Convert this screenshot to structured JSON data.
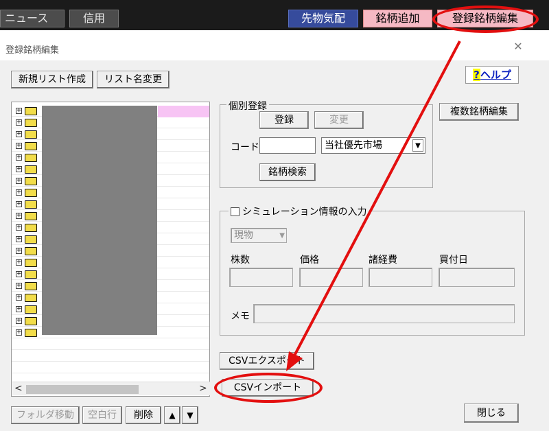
{
  "toolbar": {
    "news": "ニュース",
    "credit": "信用",
    "futures": "先物気配",
    "add_stock": "銘柄追加",
    "edit_registered": "登録銘柄編集"
  },
  "dialog": {
    "title": "登録銘柄編集",
    "close_label": "✕",
    "help_q": "?",
    "help_label": "ヘルプ",
    "new_list": "新規リスト作成",
    "rename_list": "リスト名変更",
    "multi_edit": "複数銘柄編集",
    "individual": {
      "title": "個別登録",
      "register": "登録",
      "change": "変更",
      "code_label": "コード",
      "code_value": "",
      "market_value": "当社優先市場",
      "search": "銘柄検索"
    },
    "simulation": {
      "title": "シミュレーション情報の入力",
      "trade_type": "現物",
      "shares_label": "株数",
      "price_label": "価格",
      "expenses_label": "諸経費",
      "buy_date_label": "買付日",
      "memo_label": "メモ"
    },
    "csv_export": "CSVエクスポート",
    "csv_import": "CSVインポート",
    "folder_move": "フォルダ移動",
    "blank_row": "空白行",
    "delete": "削除",
    "close": "閉じる"
  },
  "tree": {
    "folder_count": 20,
    "expand_symbol": "+"
  },
  "colors": {
    "highlight_pink": "#f6b9c4",
    "futures_blue": "#364b9c",
    "annotation_red": "#e30f0f",
    "folder_yellow": "#f2dd4a"
  }
}
